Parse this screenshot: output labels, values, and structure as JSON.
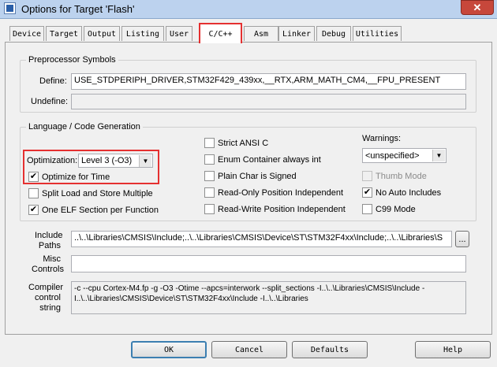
{
  "window": {
    "title": "Options for Target 'Flash'",
    "close_glyph": "✕"
  },
  "tabs": [
    "Device",
    "Target",
    "Output",
    "Listing",
    "User",
    "C/C++",
    "Asm",
    "Linker",
    "Debug",
    "Utilities"
  ],
  "preprocessor": {
    "legend": "Preprocessor Symbols",
    "define_label": "Define:",
    "define_value": "USE_STDPERIPH_DRIVER,STM32F429_439xx,__RTX,ARM_MATH_CM4,__FPU_PRESENT",
    "undefine_label": "Undefine:",
    "undefine_value": ""
  },
  "codegen": {
    "legend": "Language / Code Generation",
    "optimization_label": "Optimization:",
    "optimization_value": "Level 3 (-O3)",
    "warnings_label": "Warnings:",
    "warnings_value": "<unspecified>",
    "checkboxes": [
      {
        "label": "Optimize for Time",
        "checked": true
      },
      {
        "label": "Split Load and Store Multiple",
        "checked": false
      },
      {
        "label": "One ELF Section per Function",
        "checked": true
      },
      {
        "label": "Strict ANSI C",
        "checked": false
      },
      {
        "label": "Enum Container always int",
        "checked": false
      },
      {
        "label": "Plain Char is Signed",
        "checked": false
      },
      {
        "label": "Read-Only Position Independent",
        "checked": false
      },
      {
        "label": "Read-Write Position Independent",
        "checked": false
      },
      {
        "label": "Thumb Mode",
        "checked": false,
        "disabled": true
      },
      {
        "label": "No Auto Includes",
        "checked": true
      },
      {
        "label": "C99 Mode",
        "checked": false
      }
    ]
  },
  "include": {
    "label_line1": "Include",
    "label_line2": "Paths",
    "value": "..\\..\\Libraries\\CMSIS\\Include;..\\..\\Libraries\\CMSIS\\Device\\ST\\STM32F4xx\\Include;..\\..\\Libraries\\S",
    "browse_label": "..."
  },
  "misc": {
    "label_line1": "Misc",
    "label_line2": "Controls",
    "value": ""
  },
  "compiler": {
    "label_line1": "Compiler",
    "label_line2": "control",
    "label_line3": "string",
    "line1": "-c --cpu Cortex-M4.fp -g -O3 -Otime --apcs=interwork --split_sections -I..\\..\\Libraries\\CMSIS\\Include -",
    "line2": "I..\\..\\Libraries\\CMSIS\\Device\\ST\\STM32F4xx\\Include -I..\\..\\Libraries"
  },
  "buttons": {
    "ok": "OK",
    "cancel": "Cancel",
    "defaults": "Defaults",
    "help": "Help"
  },
  "checkmark": "✔",
  "dropdown_arrow": "▼"
}
